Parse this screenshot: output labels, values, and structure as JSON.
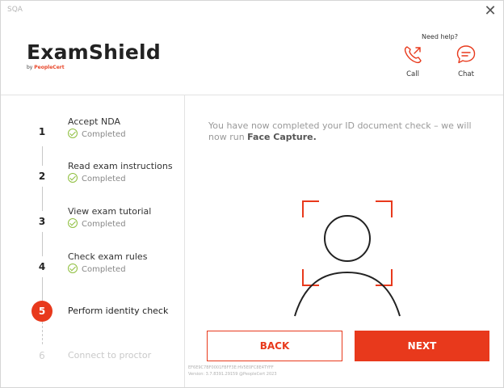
{
  "window": {
    "title": "SQA",
    "close_glyph": "✕"
  },
  "header": {
    "logo_text": "ExamShield",
    "logo_sub_prefix": "by",
    "logo_sub_brand": "PeopleCert",
    "need_help": "Need help?",
    "call_label": "Call",
    "chat_label": "Chat",
    "accent_color": "#e8391c"
  },
  "steps": [
    {
      "number": "1",
      "label": "Accept NDA",
      "status": "Completed",
      "state": "completed"
    },
    {
      "number": "2",
      "label": "Read exam instructions",
      "status": "Completed",
      "state": "completed"
    },
    {
      "number": "3",
      "label": "View exam tutorial",
      "status": "Completed",
      "state": "completed"
    },
    {
      "number": "4",
      "label": "Check exam rules",
      "status": "Completed",
      "state": "completed"
    },
    {
      "number": "5",
      "label": "Perform identity check",
      "status": "",
      "state": "active"
    },
    {
      "number": "6",
      "label": "Connect to proctor",
      "status": "",
      "state": "pending"
    }
  ],
  "main": {
    "message_prefix": "You have now completed your ID document check – we will now run",
    "message_bold": "Face Capture.",
    "back_label": "BACK",
    "next_label": "NEXT"
  },
  "footer": {
    "hash": "EF6E9C7BF0001FBFF3E:HV5E0FC8E4TYFF",
    "version": "Version: 3.7.8391.29159 @PeopleCert 2023"
  }
}
